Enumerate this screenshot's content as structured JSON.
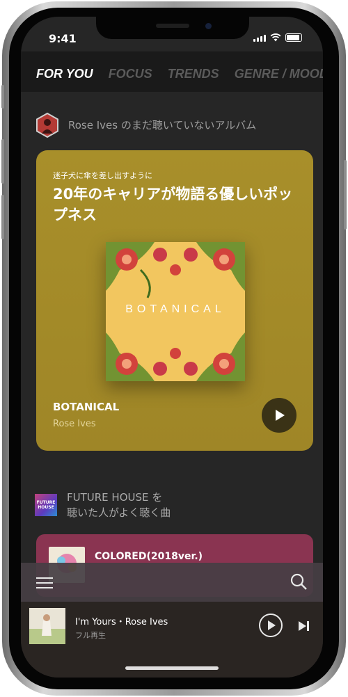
{
  "status_bar": {
    "time": "9:41"
  },
  "tabs": [
    {
      "label": "FOR YOU",
      "active": true
    },
    {
      "label": "FOCUS",
      "active": false
    },
    {
      "label": "TRENDS",
      "active": false
    },
    {
      "label": "GENRE / MOOD",
      "active": false
    }
  ],
  "section1": {
    "title": "Rose Ives のまだ聴いていないアルバム"
  },
  "feature_card": {
    "kicker": "迷子犬に傘を差し出すように",
    "headline": "20年のキャリアが物語る優しいポップネス",
    "art_text": "BOTANICAL",
    "album": "BOTANICAL",
    "artist": "Rose Ives",
    "color": "#a68d28"
  },
  "section2": {
    "title_line1": "FUTURE HOUSE を",
    "title_line2": "聴いた人がよく聴く曲",
    "thumb_text": "FUTURE HOUSE"
  },
  "rec_card": {
    "title": "COLORED(2018ver.)",
    "color": "#8a3451"
  },
  "now_playing": {
    "title": "I'm Yours・Rose Ives",
    "subtitle": "フル再生"
  },
  "icons": [
    "menu-icon",
    "search-icon",
    "play-icon",
    "next-icon",
    "wifi-icon",
    "battery-icon",
    "signal-icon"
  ]
}
